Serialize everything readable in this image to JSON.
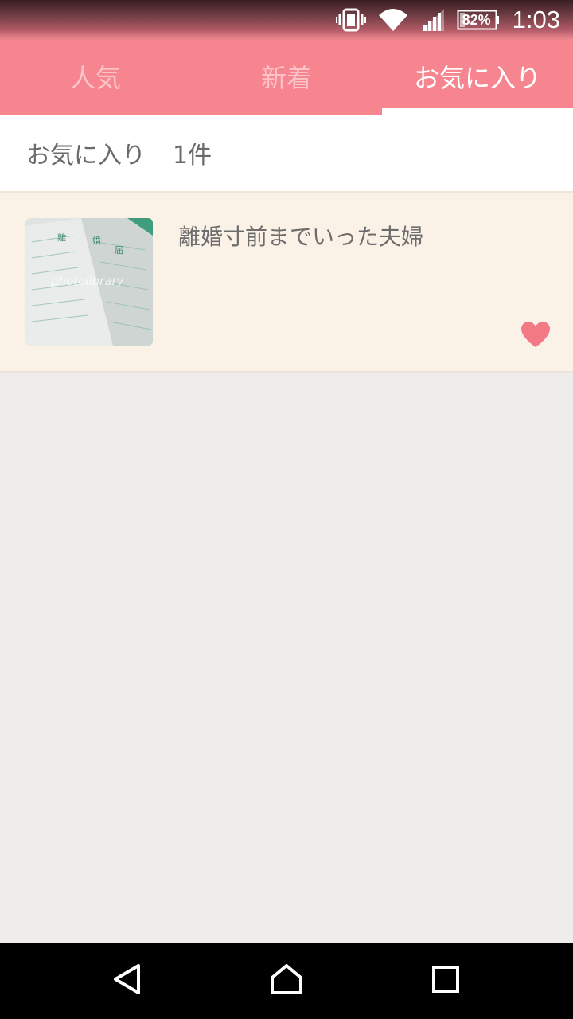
{
  "status_bar": {
    "battery_percent": "82%",
    "time": "1:03",
    "icons": [
      "vibrate-icon",
      "wifi-icon",
      "signal-icon",
      "battery-icon"
    ]
  },
  "tabs": [
    {
      "label": "人気",
      "active": false
    },
    {
      "label": "新着",
      "active": false
    },
    {
      "label": "お気に入り",
      "active": true
    }
  ],
  "favorites_header": {
    "label": "お気に入り",
    "count": "1件"
  },
  "favorites": [
    {
      "title": "離婚寸前までいった夫婦",
      "thumbnail_watermark": "photolibrary",
      "favorited": true
    }
  ],
  "colors": {
    "accent": "#f6858f",
    "heart": "#f37a85",
    "item_bg": "#faf1e7",
    "background": "#efedeb"
  },
  "nav": {
    "icons": [
      "back-icon",
      "home-icon",
      "recents-icon"
    ]
  }
}
